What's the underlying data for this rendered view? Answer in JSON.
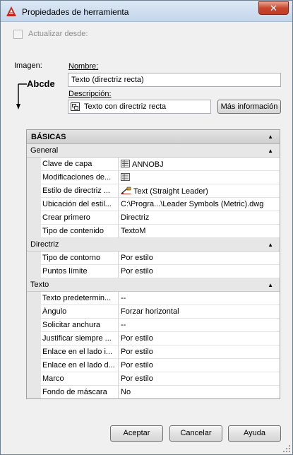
{
  "window": {
    "title": "Propiedades de herramienta",
    "close_label": "✕",
    "app_icon": "autocad-icon"
  },
  "update_from": {
    "label": "Actualizar desde:",
    "checked": false,
    "enabled": false
  },
  "image": {
    "label": "Imagen:",
    "preview_text": "Abcde"
  },
  "name": {
    "label": "Nombre:",
    "value": "Texto (directriz recta)"
  },
  "description": {
    "label": "Descripción:",
    "value": "Texto con directriz recta",
    "icon": "tool-icon"
  },
  "more_info_label": "Más información",
  "grid": {
    "section_title": "BÁSICAS",
    "categories": [
      {
        "title": "General",
        "rows": [
          {
            "name": "Clave de capa",
            "value": "ANNOBJ",
            "icon": "layer-key-icon"
          },
          {
            "name": "Modificaciones de...",
            "value": "",
            "icon": "layer-key-icon"
          },
          {
            "name": "Estilo de directriz ...",
            "value": "Text (Straight Leader)",
            "icon": "leader-style-icon"
          },
          {
            "name": "Ubicación del estil...",
            "value": "C:\\Progra...\\Leader Symbols (Metric).dwg"
          },
          {
            "name": "Crear primero",
            "value": "Directriz"
          },
          {
            "name": "Tipo de contenido",
            "value": "TextoM"
          }
        ]
      },
      {
        "title": "Directriz",
        "rows": [
          {
            "name": "Tipo de contorno",
            "value": "Por estilo"
          },
          {
            "name": "Puntos límite",
            "value": "Por estilo"
          }
        ]
      },
      {
        "title": "Texto",
        "rows": [
          {
            "name": "Texto predetermin...",
            "value": "--"
          },
          {
            "name": "Ángulo",
            "value": "Forzar horizontal"
          },
          {
            "name": "Solicitar anchura",
            "value": "--"
          },
          {
            "name": "Justificar siempre ...",
            "value": "Por estilo"
          },
          {
            "name": "Enlace en el lado i...",
            "value": "Por estilo"
          },
          {
            "name": "Enlace en el lado d...",
            "value": "Por estilo"
          },
          {
            "name": "Marco",
            "value": "Por estilo"
          },
          {
            "name": "Fondo de máscara",
            "value": "No"
          }
        ]
      }
    ]
  },
  "buttons": {
    "ok": "Aceptar",
    "cancel": "Cancelar",
    "help": "Ayuda"
  }
}
